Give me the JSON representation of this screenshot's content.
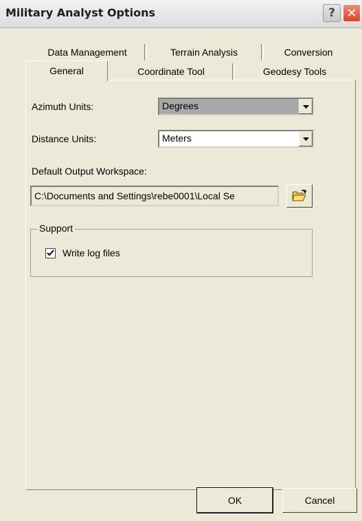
{
  "window": {
    "title": "Military Analyst Options",
    "help_glyph": "?",
    "close_glyph": "✕"
  },
  "tabs": {
    "row1": [
      "Data Management",
      "Terrain Analysis",
      "Conversion"
    ],
    "row2": [
      "General",
      "Coordinate Tool",
      "Geodesy Tools"
    ],
    "active": "General"
  },
  "general": {
    "azimuth_label": "Azimuth Units:",
    "azimuth_value": "Degrees",
    "distance_label": "Distance Units:",
    "distance_value": "Meters",
    "workspace_label": "Default Output Workspace:",
    "workspace_value": "C:\\Documents and Settings\\rebe0001\\Local Se",
    "support_group": "Support",
    "log_checkbox_label": "Write log files",
    "log_checkbox_checked": true
  },
  "buttons": {
    "ok": "OK",
    "cancel": "Cancel"
  },
  "icons": {
    "dropdown": "chevron-down-icon",
    "folder": "open-folder-icon",
    "checkmark": "checkmark-icon"
  }
}
